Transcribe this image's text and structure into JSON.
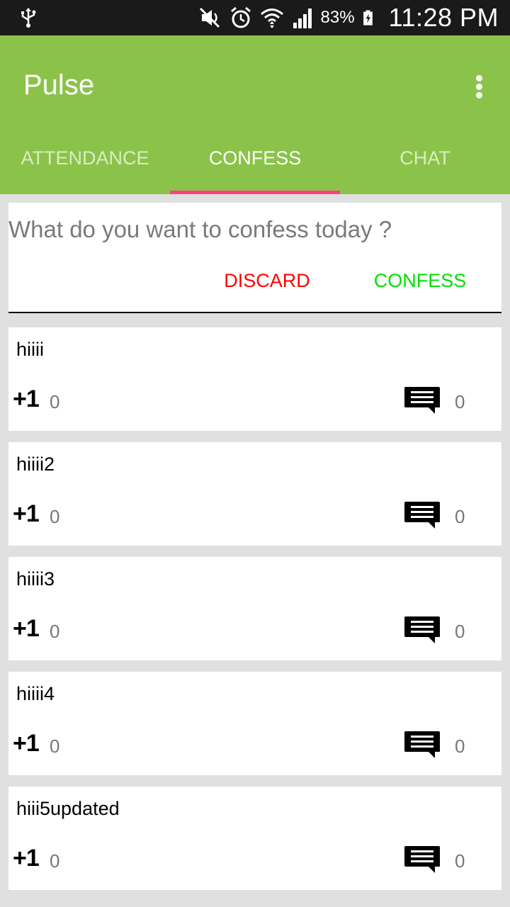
{
  "status_bar": {
    "battery": "83%",
    "time": "11:28 PM",
    "icons": [
      "usb-icon",
      "mute-icon",
      "alarm-icon",
      "wifi-icon",
      "signal-icon",
      "battery-charging-icon"
    ]
  },
  "app": {
    "title": "Pulse"
  },
  "tabs": [
    {
      "label": "ATTENDANCE"
    },
    {
      "label": "CONFESS"
    },
    {
      "label": "CHAT"
    }
  ],
  "active_tab": "CONFESS",
  "compose": {
    "placeholder": "What do you want to confess today ?",
    "value": "",
    "discard_label": "DISCARD",
    "confess_label": "CONFESS"
  },
  "posts": [
    {
      "text": "hiiii",
      "plus_label": "+1",
      "likes": "0",
      "comments": "0"
    },
    {
      "text": "hiiii2",
      "plus_label": "+1",
      "likes": "0",
      "comments": "0"
    },
    {
      "text": "hiiii3",
      "plus_label": "+1",
      "likes": "0",
      "comments": "0"
    },
    {
      "text": "hiiii4",
      "plus_label": "+1",
      "likes": "0",
      "comments": "0"
    },
    {
      "text": "hiii5updated",
      "plus_label": "+1",
      "likes": "0",
      "comments": "0"
    }
  ],
  "colors": {
    "primary": "#8bc34a",
    "accent": "#ff4081",
    "discard": "#ff0000",
    "confess": "#00e000",
    "status_bar": "#1a1a1a"
  }
}
